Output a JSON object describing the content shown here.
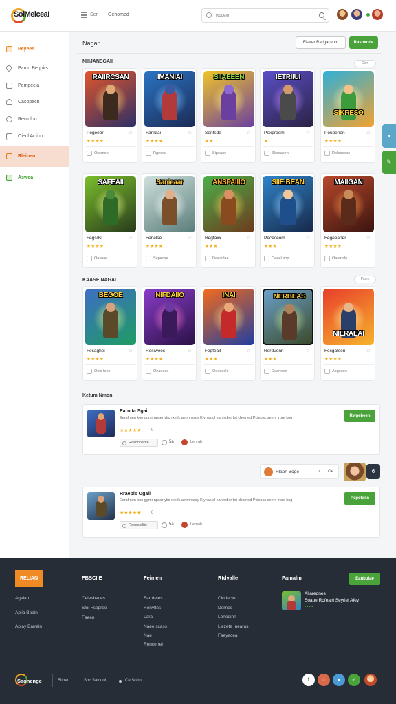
{
  "header": {
    "logo_text": "SoiMelceaI",
    "nav_label_1": "Ser",
    "nav_label_2": "Gehomed",
    "search_placeholder": "Rooeio"
  },
  "sidebar": {
    "items": [
      {
        "label": "Peyees",
        "icon": "box-icon",
        "style": "orange"
      },
      {
        "label": "Pamo Beqoirs",
        "icon": "heart-icon",
        "style": ""
      },
      {
        "label": "Pempecla",
        "icon": "document-icon",
        "style": ""
      },
      {
        "label": "Casopacn",
        "icon": "user-icon",
        "style": ""
      },
      {
        "label": "Reniolon",
        "icon": "circle-icon",
        "style": ""
      },
      {
        "label": "Oiecl Aclion",
        "icon": "flag-icon",
        "style": ""
      },
      {
        "label": "Rleioen",
        "icon": "shop-icon",
        "style": "active"
      },
      {
        "label": "Aswea",
        "icon": "book-icon",
        "style": "green"
      }
    ]
  },
  "main": {
    "title": "Nagan",
    "btn_filter": "Fiswer Ratigaceom",
    "btn_primary": "Rasbxode",
    "section1": {
      "label": "NIIIJANSGAII",
      "pill": "Oien"
    },
    "section2": {
      "label": "KAASE NAGAI",
      "pill": "Piuen"
    },
    "reviews_title": "Ketum Nmon"
  },
  "cards_row1": [
    {
      "art": "RAIIRCSAN",
      "name": "Pegeeor",
      "stars": "★★★★",
      "action": "Osemee",
      "color1": "#e2562c",
      "color2": "#2c2f66"
    },
    {
      "art": "IMANIAI",
      "name": "Fanrdai",
      "stars": "★★★★",
      "action": "Rgeose",
      "color1": "#2b74c4",
      "color2": "#1b2b55"
    },
    {
      "art": "SIIAEEEN",
      "name": "Senfsde",
      "stars": "★★",
      "action": "Sipeaoe",
      "color1": "#f0c428",
      "color2": "#6a3fa0"
    },
    {
      "art": "IETRIIUI",
      "name": "Pexpreem",
      "stars": "★",
      "action": "Slereasen",
      "color1": "#5a4fc7",
      "color2": "#2b2244"
    },
    {
      "art": "SIKRESO",
      "name": "Pouperian",
      "stars": "★★★★",
      "action": "Relooseae",
      "color1": "#2fb0d8",
      "color2": "#f2a230"
    }
  ],
  "cards_row2": [
    {
      "art": "SAFEAII",
      "name": "Fegsdst",
      "stars": "★★★★",
      "action": "Oasoae",
      "color1": "#7bbf2c",
      "color2": "#283a1c"
    },
    {
      "art": "Sanieaar",
      "name": "Fenelse",
      "stars": "★★★★",
      "action": "Sapeoxe",
      "color1": "#cfe0dc",
      "color2": "#5a7d7a"
    },
    {
      "art": "ANSPAIIIO",
      "name": "Regfaxx",
      "stars": "★★★",
      "action": "Daeanlae",
      "color1": "#4bb04a",
      "color2": "#6d3a1c"
    },
    {
      "art": "SIIE BEAN",
      "name": "Pececeom",
      "stars": "★★★",
      "action": "Oeeel eop",
      "color1": "#2f84c9",
      "color2": "#172849"
    },
    {
      "art": "MAIIGAN",
      "name": "Fegeeaper",
      "stars": "★★★★",
      "action": "Oaomaly",
      "color1": "#b9482b",
      "color2": "#3a1410"
    }
  ],
  "cards_row3": [
    {
      "art": "BEGOE",
      "name": "Fesaghei",
      "stars": "★★★★",
      "action": "Oeie tese",
      "color1": "#3d6ec4",
      "color2": "#1f9c62"
    },
    {
      "art": "NIFDAIIO",
      "name": "Rosiwees",
      "stars": "★★★★",
      "action": "Oeaoesa",
      "color1": "#8a3cc9",
      "color2": "#2a1145"
    },
    {
      "art": "INAI",
      "name": "Fegfeail",
      "stars": "★★★",
      "action": "Oeeseole",
      "color1": "#f26b1d",
      "color2": "#1f3ea0"
    },
    {
      "art": "NERBEAS",
      "name": "Rerduenn",
      "stars": "★★★",
      "action": "Deaneee",
      "color1": "#6aa0c9",
      "color2": "#3b4a2a"
    },
    {
      "art": "NIERAEAI",
      "name": "Fesgatsen",
      "stars": "★★★★",
      "action": "Apgeoee",
      "color1": "#e83e2b",
      "color2": "#f6b42c"
    }
  ],
  "reviews": [
    {
      "title": "Earolta Sgail",
      "text": "Eeraf nen koo ggmr npser ytio rxetlc aetmrosdy Klynas cl eanfsdler tet cberned Pciepac seenl trore kog",
      "stars": "★★★★★",
      "count": "0",
      "chip": "Rasonoedte",
      "likes": "5a",
      "user": "Lenrah",
      "button": "Rwgebeen"
    },
    {
      "title": "Rraepis Ogall",
      "text": "Eeraf nen koo ggmr npser ytio rxetlc aetmrosdy Klynas cl eanfsdler tet cberned Pciepac seenl trore kog",
      "stars": "★★★★★",
      "count": "0",
      "chip": "Recoslolite",
      "likes": "5a",
      "user": "Lernah",
      "button": "Pepotaen"
    }
  ],
  "pager": {
    "name": "Hlaen Boge",
    "chevron": "›",
    "number": "Oe"
  },
  "footer": {
    "brand": "RELIAN",
    "col1": {
      "title": "FBSCIIE",
      "links": [
        "Celesbaces",
        "Sloi Fsepree",
        "Faeen"
      ]
    },
    "col2": {
      "title": "Feimen",
      "links": [
        "Farrdeles",
        "Renvltes",
        "Lara",
        "Naee scass",
        "Nae",
        "Rencertel"
      ]
    },
    "col3": {
      "title": "Rtdvalle",
      "links": [
        "Clodecte",
        "Dornec",
        "Lonedinn",
        "Llezete Inearas",
        "Faeyacea"
      ]
    },
    "col4": {
      "title": "Pamalm",
      "button": "Eanbulae"
    },
    "left_links": [
      "Agelan",
      "Aplia Boain",
      "Apiay Barrain"
    ],
    "promo": {
      "title": "Aliarednes",
      "subtitle": "Soaue Rofeairl Seyriel Afey",
      "stars": "• • • •"
    },
    "logo_text": "Saonenge",
    "bottom_1": "Bitherl",
    "bottom_2": "Shc Saloool",
    "bottom_3": "Ce Sofrol",
    "social": [
      "f",
      "◌",
      "●",
      "✓",
      "☺"
    ]
  }
}
